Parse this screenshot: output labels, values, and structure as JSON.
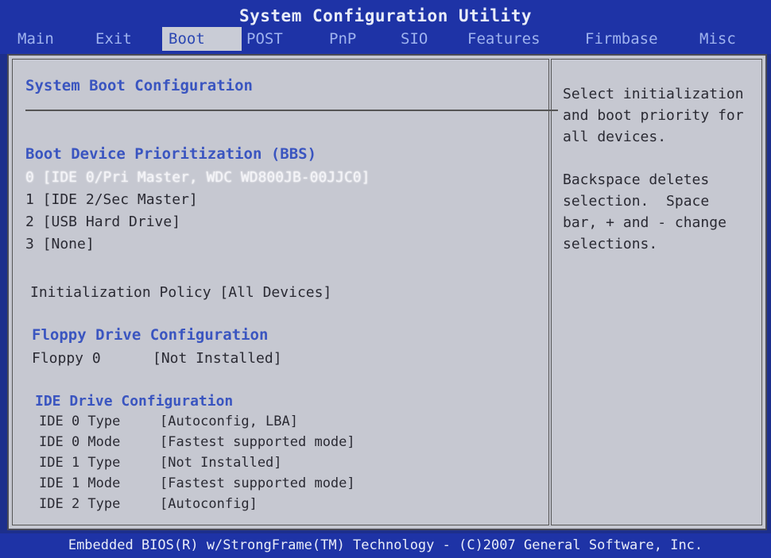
{
  "window": {
    "title": "System Configuration Utility"
  },
  "tabs": [
    {
      "label": "Main"
    },
    {
      "label": "Exit"
    },
    {
      "label": "Boot"
    },
    {
      "label": "POST"
    },
    {
      "label": "PnP"
    },
    {
      "label": "SIO"
    },
    {
      "label": "Features"
    },
    {
      "label": "Firmbase"
    },
    {
      "label": "Misc"
    }
  ],
  "main": {
    "section_title": "System Boot Configuration",
    "boot_priority": {
      "heading": "Boot Device Prioritization (BBS)",
      "items": [
        {
          "text": "0 [IDE 0/Pri Master, WDC WD800JB-00JJC0]"
        },
        {
          "text": "1 [IDE 2/Sec Master]"
        },
        {
          "text": "2 [USB Hard Drive]"
        },
        {
          "text": "3 [None]"
        }
      ]
    },
    "init_policy": "Initialization Policy [All Devices]",
    "floppy": {
      "heading": "Floppy Drive Configuration",
      "label": "Floppy 0",
      "value": "[Not Installed]"
    },
    "ide": {
      "heading": "IDE Drive Configuration",
      "rows": [
        {
          "label": "IDE 0 Type",
          "value": "[Autoconfig, LBA]"
        },
        {
          "label": "IDE 0 Mode",
          "value": "[Fastest supported mode]"
        },
        {
          "label": "IDE 1 Type",
          "value": "[Not Installed]"
        },
        {
          "label": "IDE 1 Mode",
          "value": "[Fastest supported mode]"
        },
        {
          "label": "IDE 2 Type",
          "value": "[Autoconfig]"
        }
      ]
    }
  },
  "help": {
    "lines": [
      "Select initialization",
      "and boot priority for",
      "all devices.",
      "",
      "Backspace deletes",
      "selection.  Space",
      "bar, + and - change",
      "selections."
    ]
  },
  "footer": {
    "text": "Embedded BIOS(R) w/StrongFrame(TM) Technology - (C)2007 General Software, Inc."
  },
  "colors": {
    "header_bg": "#1e33a6",
    "panel_bg": "#c6c8d1",
    "accent": "#3a55c0"
  }
}
